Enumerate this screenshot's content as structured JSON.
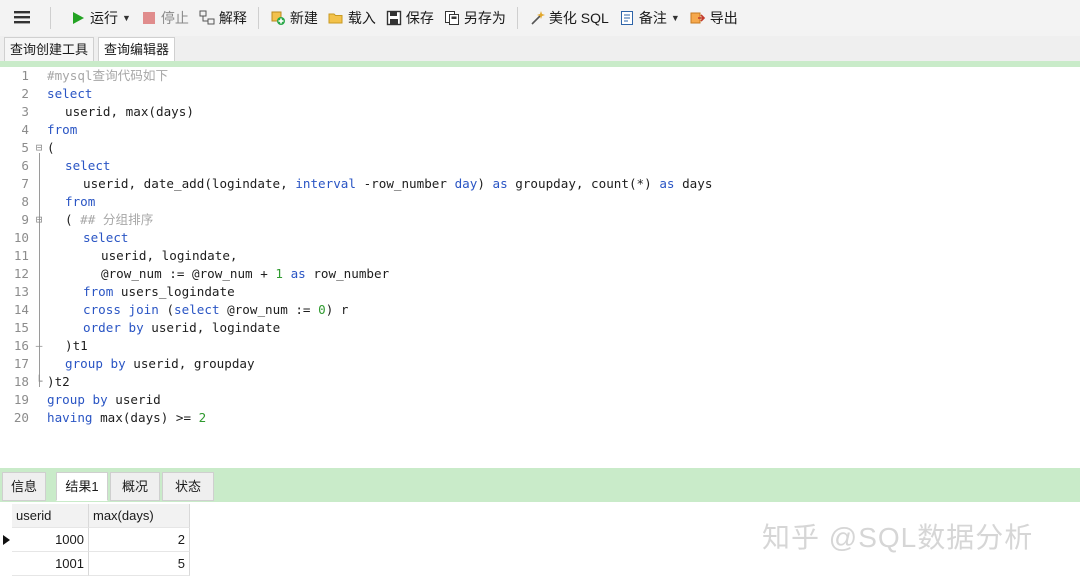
{
  "toolbar": {
    "run_label": "运行",
    "stop_label": "停止",
    "explain_label": "解释",
    "new_label": "新建",
    "load_label": "载入",
    "save_label": "保存",
    "save_as_label": "另存为",
    "beautify_label": "美化 SQL",
    "note_label": "备注",
    "export_label": "导出"
  },
  "query_tabs": [
    "查询创建工具",
    "查询编辑器"
  ],
  "editor": {
    "lines": [
      "#mysql查询代码如下",
      "select",
      "userid, max(days)",
      "from",
      "(",
      "select",
      "userid, date_add(logindate, interval -row_number day) as groupday, count(*) as days",
      "from",
      "( ## 分组排序",
      "select",
      "userid, logindate,",
      "@row_num := @row_num + 1 as row_number",
      "from users_logindate",
      "cross join (select @row_num := 0) r",
      "order by userid, logindate",
      ")t1",
      "group by userid, groupday",
      ")t2",
      "group by userid",
      "having max(days) >= 2"
    ]
  },
  "result_tabs": [
    "信息",
    "结果1",
    "概况",
    "状态"
  ],
  "result_grid": {
    "columns": [
      "userid",
      "max(days)"
    ],
    "rows": [
      [
        "1000",
        "2"
      ],
      [
        "1001",
        "5"
      ]
    ]
  },
  "watermark": "知乎 @SQL数据分析",
  "colors": {
    "keyword": "#2a55c4",
    "number": "#2f9a2f",
    "comment": "#a7a7a7",
    "accent": "#c9ebc9"
  }
}
